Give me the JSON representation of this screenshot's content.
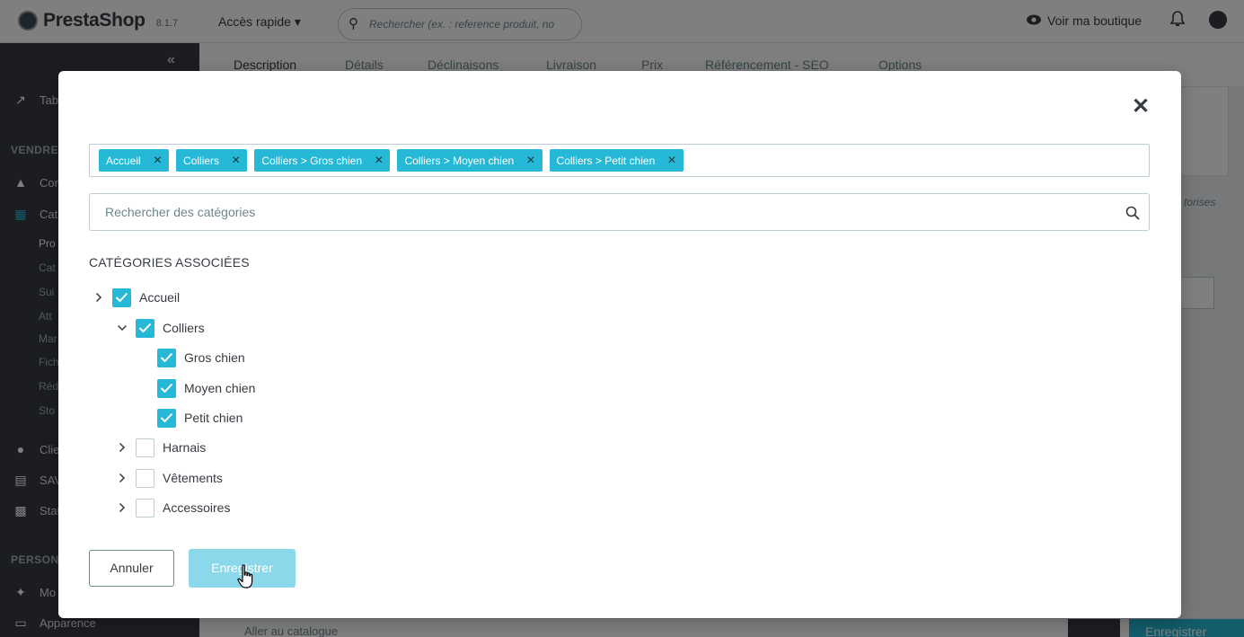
{
  "app": {
    "logo_text": "PrestaShop",
    "version": "8.1.7",
    "quick_access": "Accès rapide ▾",
    "search_placeholder": "Rechercher (ex. : reference produit, no",
    "view_shop": "Voir ma boutique"
  },
  "sidebar": {
    "items": [
      {
        "label": "Tab",
        "icon": "trending-up-icon"
      },
      {
        "label": "Cor",
        "icon": "basket-icon"
      },
      {
        "label": "Cat",
        "icon": "store-icon"
      },
      {
        "label": "Clie",
        "icon": "user-circle-icon"
      },
      {
        "label": "SAV",
        "icon": "chat-icon"
      },
      {
        "label": "Stat",
        "icon": "chart-icon"
      },
      {
        "label": "Mo",
        "icon": "puzzle-icon"
      },
      {
        "label": "Apparence",
        "icon": "monitor-icon"
      }
    ],
    "sections": [
      "VENDRE",
      "PERSON"
    ],
    "subitems": [
      "Pro",
      "Cat",
      "Sui",
      "Att",
      "Mar",
      "Fich",
      "Réd",
      "Sto"
    ]
  },
  "product_tabs": [
    "Description",
    "Détails",
    "Déclinaisons",
    "Livraison",
    "Prix",
    "Référencement - SEO",
    "Options"
  ],
  "background": {
    "right_text": "torises",
    "footer_left": "Aller au catalogue",
    "footer_save": "Enregistrer"
  },
  "modal": {
    "tags": [
      "Accueil",
      "Colliers",
      "Colliers > Gros chien",
      "Colliers > Moyen chien",
      "Colliers > Petit chien"
    ],
    "search_placeholder": "Rechercher des catégories",
    "section_title": "CATÉGORIES ASSOCIÉES",
    "tree": [
      {
        "label": "Accueil",
        "checked": true,
        "expander": "collapsed",
        "level": 0
      },
      {
        "label": "Colliers",
        "checked": true,
        "expander": "expanded",
        "level": 1
      },
      {
        "label": "Gros chien",
        "checked": true,
        "expander": "none",
        "level": 2
      },
      {
        "label": "Moyen chien",
        "checked": true,
        "expander": "none",
        "level": 2
      },
      {
        "label": "Petit chien",
        "checked": true,
        "expander": "none",
        "level": 2
      },
      {
        "label": "Harnais",
        "checked": false,
        "expander": "collapsed",
        "level": 1
      },
      {
        "label": "Vêtements",
        "checked": false,
        "expander": "collapsed",
        "level": 1
      },
      {
        "label": "Accessoires",
        "checked": false,
        "expander": "collapsed",
        "level": 1
      }
    ],
    "cancel_label": "Annuler",
    "save_label": "Enregistrer"
  },
  "colors": {
    "accent": "#25b9d7",
    "save_button_hover": "#8ad8e9",
    "sidebar": "#363a41"
  }
}
